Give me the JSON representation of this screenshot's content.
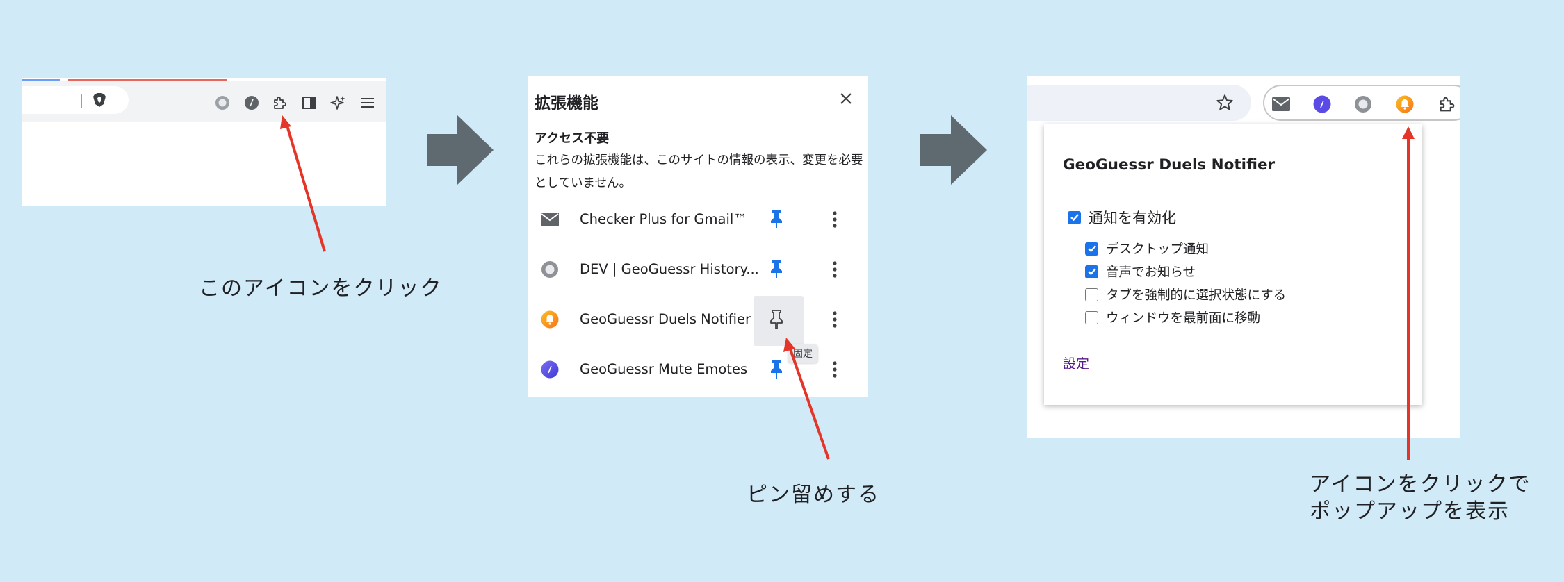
{
  "step1": {
    "caption": "このアイコンをクリック"
  },
  "step2": {
    "menu_title": "拡張機能",
    "section_title": "アクセス不要",
    "section_desc": "これらの拡張機能は、このサイトの情報の表示、変更を必要としていません。",
    "extensions": [
      {
        "name": "Checker Plus for Gmail™",
        "icon": "mail-icon",
        "pinned": true
      },
      {
        "name": "DEV | GeoGuessr History...",
        "icon": "grey-circle-icon",
        "pinned": true
      },
      {
        "name": "GeoGuessr Duels Notifier",
        "icon": "bell-icon",
        "pinned": false
      },
      {
        "name": "GeoGuessr Mute Emotes",
        "icon": "slash-circle-icon",
        "pinned": true
      }
    ],
    "tooltip": "固定",
    "caption": "ピン留めする"
  },
  "step3": {
    "popup_title": "GeoGuessr Duels Notifier",
    "main_option": {
      "label": "通知を有効化",
      "checked": true
    },
    "sub_options": [
      {
        "label": "デスクトップ通知",
        "checked": true
      },
      {
        "label": "音声でお知らせ",
        "checked": true
      },
      {
        "label": "タブを強制的に選択状態にする",
        "checked": false
      },
      {
        "label": "ウィンドウを最前面に移動",
        "checked": false
      }
    ],
    "settings_link": "設定",
    "caption_line1": "アイコンをクリックで",
    "caption_line2": "ポップアップを表示"
  },
  "colors": {
    "background": "#d0eaf7",
    "arrow": "#5e6a70",
    "annotation_red": "#e53528",
    "pin_blue": "#1a73e8",
    "checkbox_blue": "#1a73e8",
    "bell_orange": "#f59e0b",
    "slash_purple": "#5b4be6"
  }
}
